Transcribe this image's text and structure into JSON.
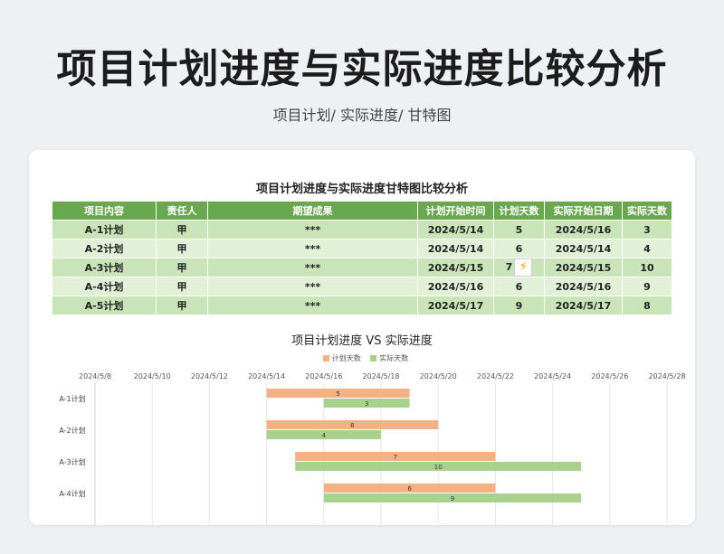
{
  "header": {
    "title": "项目计划进度与实际进度比较分析",
    "subtitle": "项目计划/  实际进度/  甘特图"
  },
  "table": {
    "title": "项目计划进度与实际进度甘特图比较分析",
    "columns": [
      "项目内容",
      "责任人",
      "期望成果",
      "计划开始时间",
      "计划天数",
      "实际开始日期",
      "实际天数"
    ],
    "rows": [
      [
        "A-1计划",
        "甲",
        "***",
        "2024/5/14",
        "5",
        "2024/5/16",
        "3"
      ],
      [
        "A-2计划",
        "甲",
        "***",
        "2024/5/14",
        "6",
        "2024/5/14",
        "4"
      ],
      [
        "A-3计划",
        "甲",
        "***",
        "2024/5/15",
        "7",
        "2024/5/15",
        "10"
      ],
      [
        "A-4计划",
        "甲",
        "***",
        "2024/5/16",
        "6",
        "2024/5/16",
        "9"
      ],
      [
        "A-5计划",
        "甲",
        "***",
        "2024/5/17",
        "9",
        "2024/5/17",
        "8"
      ]
    ],
    "icon": "lightning-icon",
    "colors": {
      "header": "#6aa84f",
      "row_dark": "#c9e4b9",
      "row_light": "#e2f0d8"
    }
  },
  "chart_data": {
    "type": "bar",
    "orientation": "horizontal-gantt",
    "title": "项目计划进度 VS 实际进度",
    "x_ticks": [
      "2024/5/8",
      "2024/5/10",
      "2024/5/12",
      "2024/5/14",
      "2024/5/16",
      "2024/5/18",
      "2024/5/20",
      "2024/5/22",
      "2024/5/24",
      "2024/5/26",
      "2024/5/28"
    ],
    "xlim": [
      "2024/5/8",
      "2024/5/28"
    ],
    "categories": [
      "A-1计划",
      "A-2计划",
      "A-3计划",
      "A-4计划"
    ],
    "series": [
      {
        "name": "计划天数",
        "color": "#f4b183",
        "start": [
          "2024/5/14",
          "2024/5/14",
          "2024/5/15",
          "2024/5/16"
        ],
        "values": [
          5,
          6,
          7,
          6
        ]
      },
      {
        "name": "实际天数",
        "color": "#a9d18e",
        "start": [
          "2024/5/16",
          "2024/5/14",
          "2024/5/15",
          "2024/5/16"
        ],
        "values": [
          3,
          4,
          10,
          9
        ]
      }
    ],
    "legend": "top",
    "grid": true
  }
}
